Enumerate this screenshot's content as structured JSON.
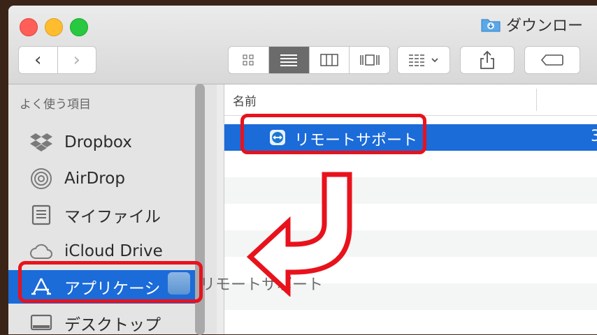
{
  "window": {
    "title": "ダウンロー"
  },
  "toolbar": {
    "back": "‹",
    "forward": "›",
    "views": [
      "icon-view",
      "list-view",
      "column-view",
      "cover-flow-view"
    ],
    "active_view": 1
  },
  "sidebar": {
    "section_title": "よく使う項目",
    "items": [
      {
        "label": "Dropbox",
        "icon": "dropbox-icon"
      },
      {
        "label": "AirDrop",
        "icon": "airdrop-icon"
      },
      {
        "label": "マイファイル",
        "icon": "my-files-icon"
      },
      {
        "label": "iCloud Drive",
        "icon": "icloud-icon"
      },
      {
        "label": "アプリケーシ",
        "icon": "applications-icon",
        "selected": true
      },
      {
        "label": "デスクトップ",
        "icon": "desktop-icon"
      }
    ]
  },
  "content": {
    "column_name": "名前",
    "selected_file": {
      "name": "リモートサポート",
      "trailing": "3"
    }
  },
  "drag": {
    "label": "リモートサポート"
  },
  "colors": {
    "accent": "#1b6bd9",
    "highlight": "#e8121c"
  }
}
